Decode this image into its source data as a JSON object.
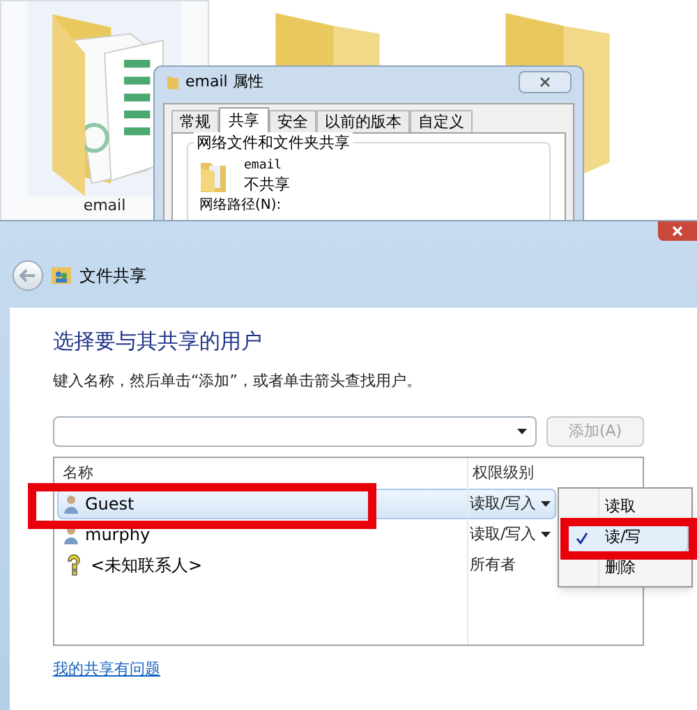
{
  "explorer": {
    "folders": [
      {
        "kind": "documents",
        "label": "email",
        "selected": true
      },
      {
        "kind": "plain",
        "selected": false
      },
      {
        "kind": "plain",
        "selected": false
      }
    ]
  },
  "properties_window": {
    "title": "email 属性",
    "tabs": [
      {
        "label": "常规",
        "selected": false
      },
      {
        "label": "共享",
        "selected": true
      },
      {
        "label": "安全",
        "selected": false
      },
      {
        "label": "以前的版本",
        "selected": false
      },
      {
        "label": "自定义",
        "selected": false
      }
    ],
    "group_title": "网络文件和文件夹共享",
    "folder_name": "email",
    "share_status": "不共享",
    "network_path_label": "网络路径(N):"
  },
  "dialog": {
    "title": "文件共享",
    "heading": "选择要与其共享的用户",
    "instruction": "键入名称，然后单击“添加”，或者单击箭头查找用户。",
    "add_button": {
      "label": "添加(A)",
      "disabled": true
    },
    "table": {
      "columns": [
        "名称",
        "权限级别"
      ],
      "rows": [
        {
          "kind": "user",
          "name": "Guest",
          "permission": "读取/写入",
          "selected": true,
          "dropdown": true
        },
        {
          "kind": "user",
          "name": "murphy",
          "permission": "读取/写入",
          "selected": false,
          "dropdown": true
        },
        {
          "kind": "unknown",
          "name": "<未知联系人>",
          "permission": "所有者",
          "selected": false,
          "dropdown": false
        }
      ]
    },
    "context_menu": [
      {
        "label": "读取",
        "checked": false,
        "selected": false
      },
      {
        "label": "读/写",
        "checked": true,
        "selected": true
      },
      {
        "label": "删除",
        "checked": false,
        "selected": false
      }
    ],
    "help_link": "我的共享有问题"
  }
}
